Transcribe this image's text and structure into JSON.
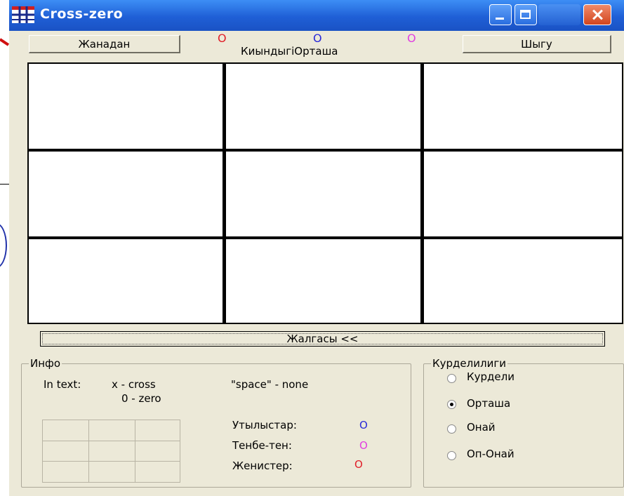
{
  "window": {
    "title": "Cross-zero"
  },
  "toolbar": {
    "new_game_label": "Жанадан",
    "exit_label": "Шыгу"
  },
  "status": {
    "mark_red": "O",
    "mark_blue": "O",
    "mark_pink": "O",
    "difficulty_text": "КиындыгiОрташа"
  },
  "board": {
    "rows": 3,
    "cols": 3,
    "cells": [
      "",
      "",
      "",
      "",
      "",
      "",
      "",
      "",
      ""
    ]
  },
  "continue_label": "Жалгасы <<",
  "info": {
    "legend": "Инфо",
    "in_text_label": "In text:",
    "cross_text": "x - cross",
    "zero_text": "0 - zero",
    "space_text": "\"space\" - none",
    "wins_label": "Утылыстар:",
    "wins_mark": "O",
    "draws_label": "Тенбе-тен:",
    "draws_mark": "O",
    "losses_label": "Женистер:",
    "losses_mark": "O"
  },
  "difficulty": {
    "legend": "Курделилиги",
    "options": [
      {
        "label": "Курдели",
        "checked": false
      },
      {
        "label": "Орташа",
        "checked": true
      },
      {
        "label": "Онай",
        "checked": false
      },
      {
        "label": "Оп-Онай",
        "checked": false
      }
    ]
  },
  "colors": {
    "red": "#e0202a",
    "blue": "#2a2ad8",
    "pink": "#e040e0",
    "titlebar": "#1f5fd6"
  }
}
